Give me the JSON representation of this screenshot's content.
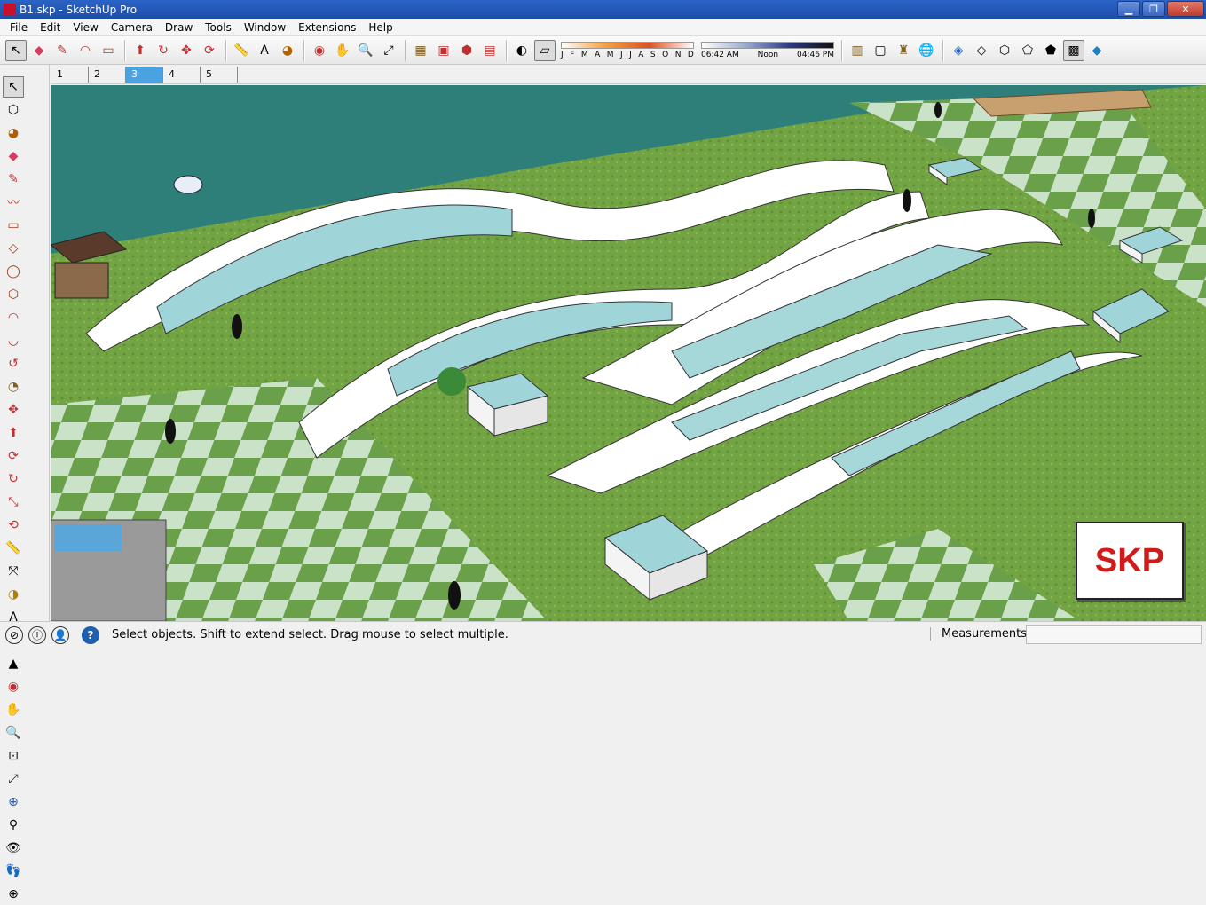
{
  "window": {
    "title": "B1.skp - SketchUp Pro"
  },
  "menu": [
    "File",
    "Edit",
    "View",
    "Camera",
    "Draw",
    "Tools",
    "Window",
    "Extensions",
    "Help"
  ],
  "shadows": {
    "months": [
      "J",
      "F",
      "M",
      "A",
      "M",
      "J",
      "J",
      "A",
      "S",
      "O",
      "N",
      "D"
    ],
    "time_start": "06:42 AM",
    "time_mid": "Noon",
    "time_end": "04:46 PM"
  },
  "scenes": [
    "1",
    "2",
    "3",
    "4",
    "5"
  ],
  "active_scene": "3",
  "status": {
    "message": "Select objects. Shift to extend select. Drag mouse to select multiple.",
    "measurements_label": "Measurements",
    "measurements_value": ""
  },
  "logo_text": "SKP",
  "colors": {
    "grass": "#6a9a40",
    "water": "#2e7f7a",
    "accent": "#4aa3e0",
    "logo_red": "#d11a1a"
  }
}
